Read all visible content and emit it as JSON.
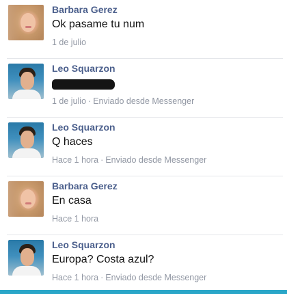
{
  "messages": [
    {
      "author": "Barbara Gerez",
      "text": "Ok pasame tu num",
      "time": "1 de julio",
      "via": ""
    },
    {
      "author": "Leo Squarzon",
      "text": "",
      "time": "1 de julio",
      "via": "Enviado desde Messenger"
    },
    {
      "author": "Leo Squarzon",
      "text": "Q haces",
      "time": "Hace 1 hora",
      "via": "Enviado desde Messenger"
    },
    {
      "author": "Barbara Gerez",
      "text": "En casa",
      "time": "Hace 1 hora",
      "via": ""
    },
    {
      "author": "Leo Squarzon",
      "text": "Europa? Costa azul?",
      "time": "Hace 1 hora",
      "via": "Enviado desde Messenger"
    }
  ],
  "separator": "·",
  "colors": {
    "author_name": "#4b5f8c",
    "message_text": "#111111",
    "meta_text": "#9197a3",
    "accent_bar": "#2aa6c8"
  }
}
